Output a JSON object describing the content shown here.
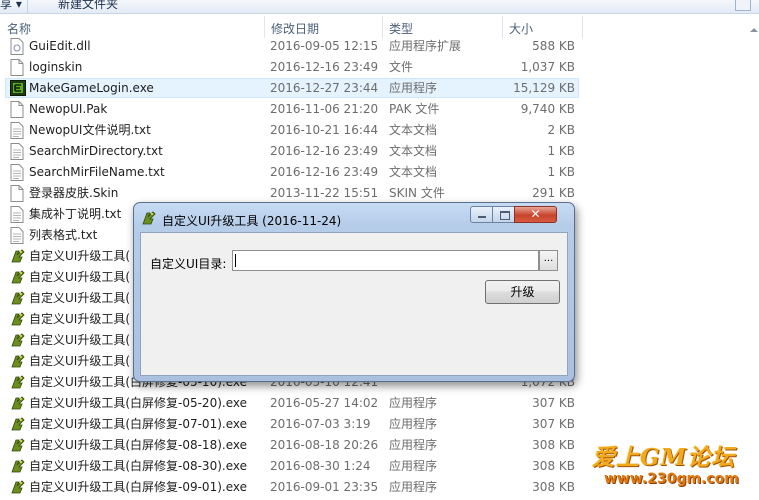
{
  "toolbar": {
    "left_item": "享 ▾",
    "new_folder": "新建文件夹"
  },
  "columns": {
    "name": "名称",
    "date": "修改日期",
    "type": "类型",
    "size": "大小"
  },
  "files": [
    {
      "name": "GuiEdit.dll",
      "date": "2016-09-05 12:15",
      "type": "应用程序扩展",
      "size": "588 KB",
      "icon": "dll-icon"
    },
    {
      "name": "loginskin",
      "date": "2016-12-16 23:49",
      "type": "文件",
      "size": "1,037 KB",
      "icon": "file-icon"
    },
    {
      "name": "MakeGameLogin.exe",
      "date": "2016-12-27 23:44",
      "type": "应用程序",
      "size": "15,129 KB",
      "icon": "exe-green-icon",
      "selected": true
    },
    {
      "name": "NewopUI.Pak",
      "date": "2016-11-06 21:20",
      "type": "PAK 文件",
      "size": "9,740 KB",
      "icon": "file-icon"
    },
    {
      "name": "NewopUI文件说明.txt",
      "date": "2016-10-21 16:44",
      "type": "文本文档",
      "size": "2 KB",
      "icon": "text-file-icon"
    },
    {
      "name": "SearchMirDirectory.txt",
      "date": "2016-12-16 23:49",
      "type": "文本文档",
      "size": "1 KB",
      "icon": "text-file-icon"
    },
    {
      "name": "SearchMirFileName.txt",
      "date": "2016-12-16 23:49",
      "type": "文本文档",
      "size": "1 KB",
      "icon": "text-file-icon"
    },
    {
      "name": "登录器皮肤.Skin",
      "date": "2013-11-22 15:51",
      "type": "SKIN 文件",
      "size": "291 KB",
      "icon": "file-icon"
    },
    {
      "name": "集成补丁说明.txt",
      "date": "",
      "type": "",
      "size": "",
      "icon": "text-file-icon"
    },
    {
      "name": "列表格式.txt",
      "date": "",
      "type": "",
      "size": "",
      "icon": "text-file-icon"
    },
    {
      "name": "自定义UI升级工具(",
      "date": "",
      "type": "",
      "size": "",
      "icon": "app-dragon-icon"
    },
    {
      "name": "自定义UI升级工具(",
      "date": "",
      "type": "",
      "size": "",
      "icon": "app-dragon-icon"
    },
    {
      "name": "自定义UI升级工具(",
      "date": "",
      "type": "",
      "size": "",
      "icon": "app-dragon-icon"
    },
    {
      "name": "自定义UI升级工具(",
      "date": "",
      "type": "",
      "size": "",
      "icon": "app-dragon-icon"
    },
    {
      "name": "自定义UI升级工具(",
      "date": "",
      "type": "",
      "size": "",
      "icon": "app-dragon-icon"
    },
    {
      "name": "自定义UI升级工具(",
      "date": "",
      "type": "",
      "size": "",
      "icon": "app-dragon-icon"
    },
    {
      "name": "自定义UI升级工具(白屏修复-05-10).exe",
      "date": "2016-05-10 12:41",
      "type": "",
      "size": "1,072 KB",
      "icon": "app-dragon-icon"
    },
    {
      "name": "自定义UI升级工具(白屏修复-05-20).exe",
      "date": "2016-05-27 14:02",
      "type": "应用程序",
      "size": "307 KB",
      "icon": "app-dragon-icon"
    },
    {
      "name": "自定义UI升级工具(白屏修复-07-01).exe",
      "date": "2016-07-03 3:19",
      "type": "应用程序",
      "size": "307 KB",
      "icon": "app-dragon-icon"
    },
    {
      "name": "自定义UI升级工具(白屏修复-08-18).exe",
      "date": "2016-08-18 20:26",
      "type": "应用程序",
      "size": "308 KB",
      "icon": "app-dragon-icon"
    },
    {
      "name": "自定义UI升级工具(白屏修复-08-30).exe",
      "date": "2016-08-30 1:24",
      "type": "应用程序",
      "size": "308 KB",
      "icon": "app-dragon-icon"
    },
    {
      "name": "自定义UI升级工具(白屏修复-09-01).exe",
      "date": "2016-09-01 23:35",
      "type": "应用程序",
      "size": "308 KB",
      "icon": "app-dragon-icon"
    }
  ],
  "dialog": {
    "title": "自定义UI升级工具 (2016-11-24)",
    "dir_label": "自定义UI目录:",
    "dir_value": "",
    "browse_label": "...",
    "upgrade_button": "升级",
    "close_glyph": "✕"
  },
  "watermark": {
    "line1": "爱上GM论坛",
    "line2": "www.230gm.com"
  }
}
